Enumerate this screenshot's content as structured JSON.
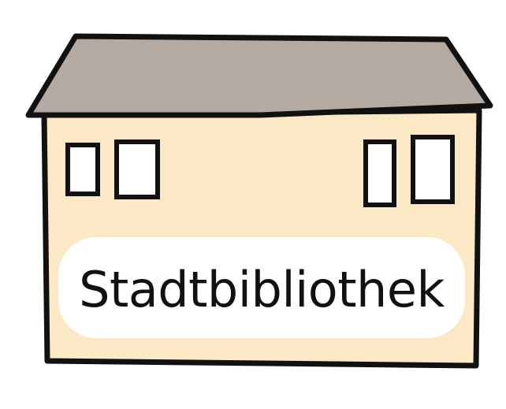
{
  "building": {
    "sign_text": "Stadtbibliothek"
  },
  "colors": {
    "roof": "#b5aaa1",
    "wall": "#fbe8c4",
    "window": "#ffffff",
    "sign": "#ffffff",
    "outline": "#111111"
  }
}
